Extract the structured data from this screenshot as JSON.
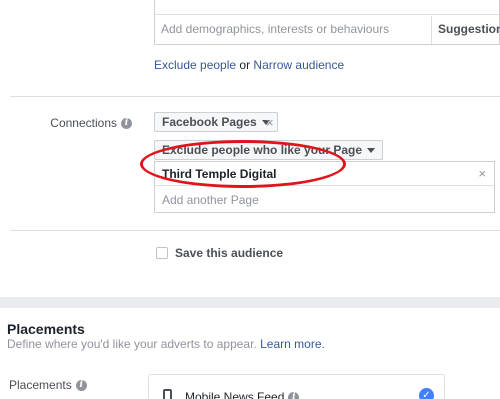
{
  "detailed_targeting": {
    "input_placeholder": "Add demographics, interests or behaviours",
    "suggestions_label": "Suggestions"
  },
  "audience_links": {
    "exclude_people": "Exclude people",
    "or": "or",
    "narrow_audience": "Narrow audience"
  },
  "connections": {
    "label": "Connections",
    "type_dropdown": "Facebook Pages",
    "rule_dropdown": "Exclude people who like your Page",
    "selected_pages": [
      "Third Temple Digital"
    ],
    "add_page_placeholder": "Add another Page",
    "highlight_color": "#e0141b"
  },
  "save_audience": {
    "label": "Save this audience",
    "checked": false
  },
  "placements_section": {
    "title": "Placements",
    "subtitle": "Define where you'd like your adverts to appear.",
    "learn_more": "Learn more.",
    "field_label": "Placements",
    "first_item": "Mobile News Feed",
    "first_item_checked": true
  },
  "colors": {
    "link": "#365899",
    "accent": "#4080ff",
    "muted": "#90949c"
  },
  "icons": {
    "info": "info-icon",
    "caret": "caret-down-icon",
    "close": "close-icon",
    "mobile": "mobile-phone-icon",
    "check": "check-circle-icon"
  }
}
